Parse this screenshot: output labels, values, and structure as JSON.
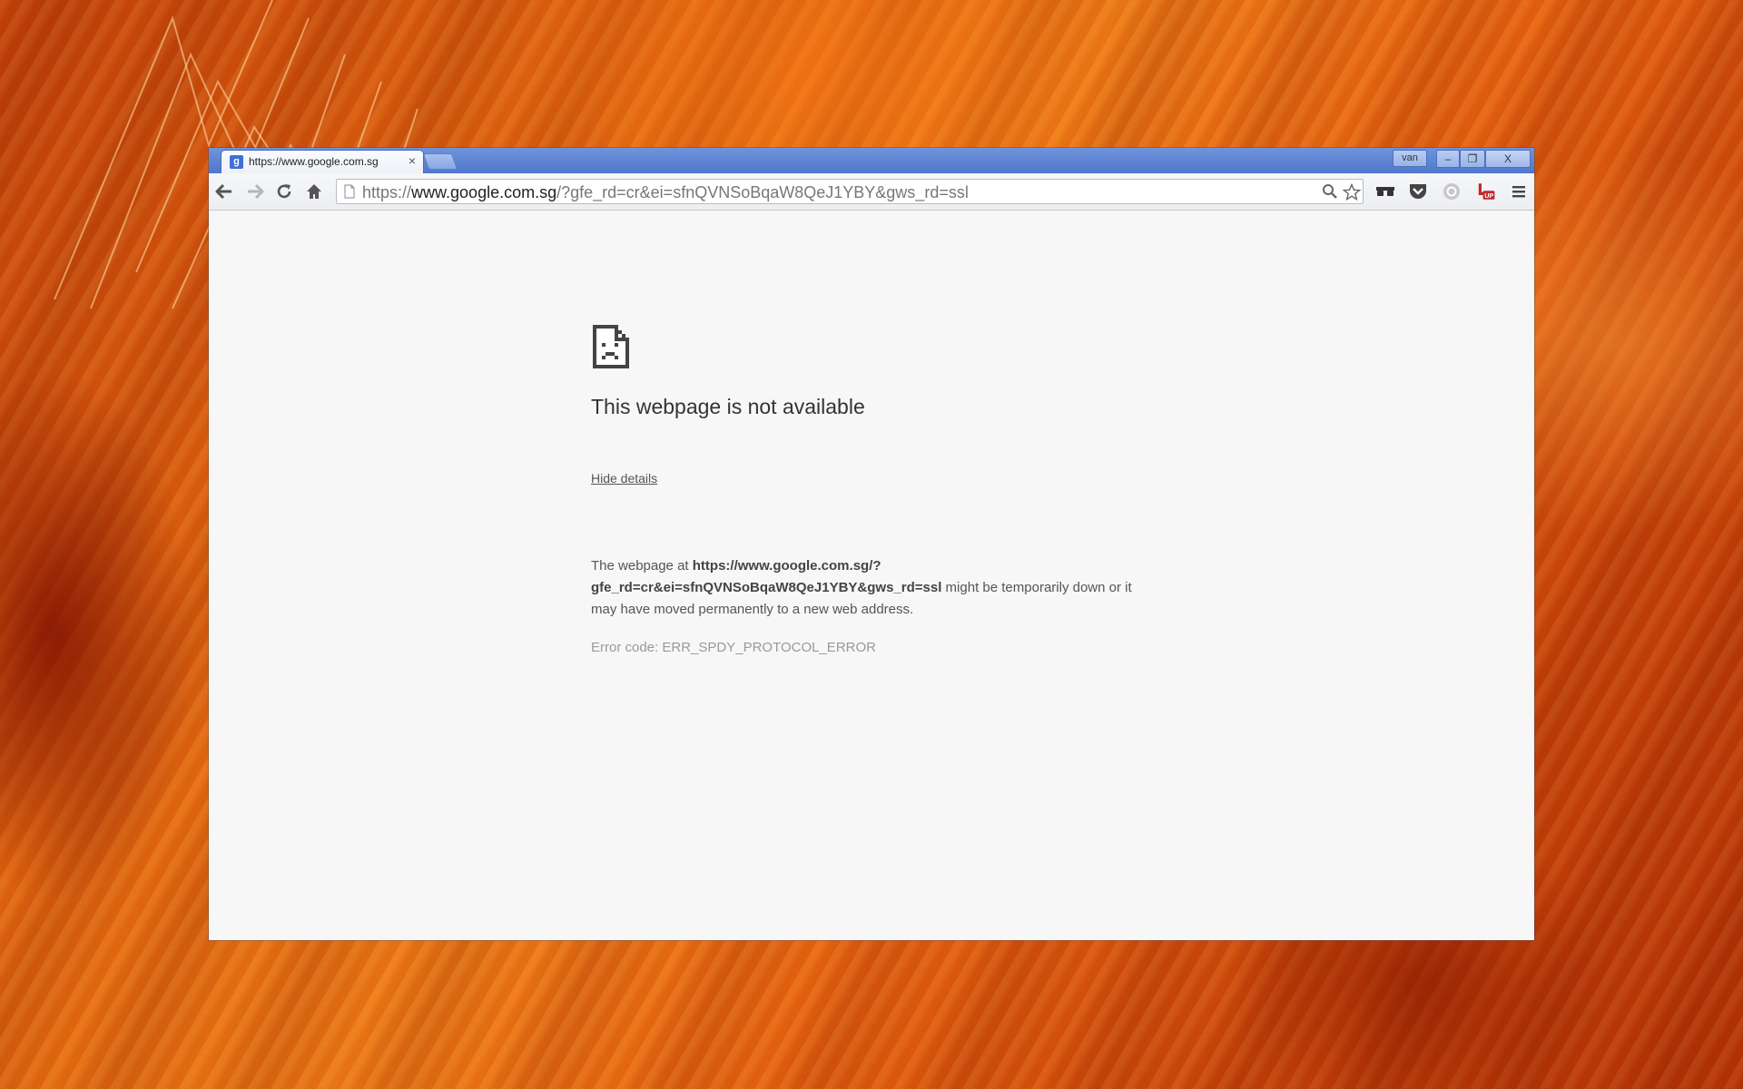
{
  "window": {
    "user_label": "van",
    "controls": {
      "minimize": "–",
      "maximize": "❐",
      "close": "X"
    }
  },
  "tab": {
    "title": "https://www.google.com.sg",
    "favicon": "g",
    "close": "×"
  },
  "toolbar": {
    "url_scheme": "https://",
    "url_domain": "www.google.com.sg",
    "url_rest": "/?gfe_rd=cr&ei=sfnQVNSoBqaW8QeJ1YBY&gws_rd=ssl"
  },
  "error_page": {
    "heading": "This webpage is not available",
    "details_link": "Hide details",
    "desc_prefix": "The webpage at ",
    "desc_url_line1": "https://www.google.com.sg/?",
    "desc_url_line2": "gfe_rd=cr&ei=sfnQVNSoBqaW8QeJ1YBY&gws_rd=ssl",
    "desc_suffix": " might be temporarily down or it may have moved permanently to a new web address.",
    "error_code": "Error code: ERR_SPDY_PROTOCOL_ERROR"
  }
}
